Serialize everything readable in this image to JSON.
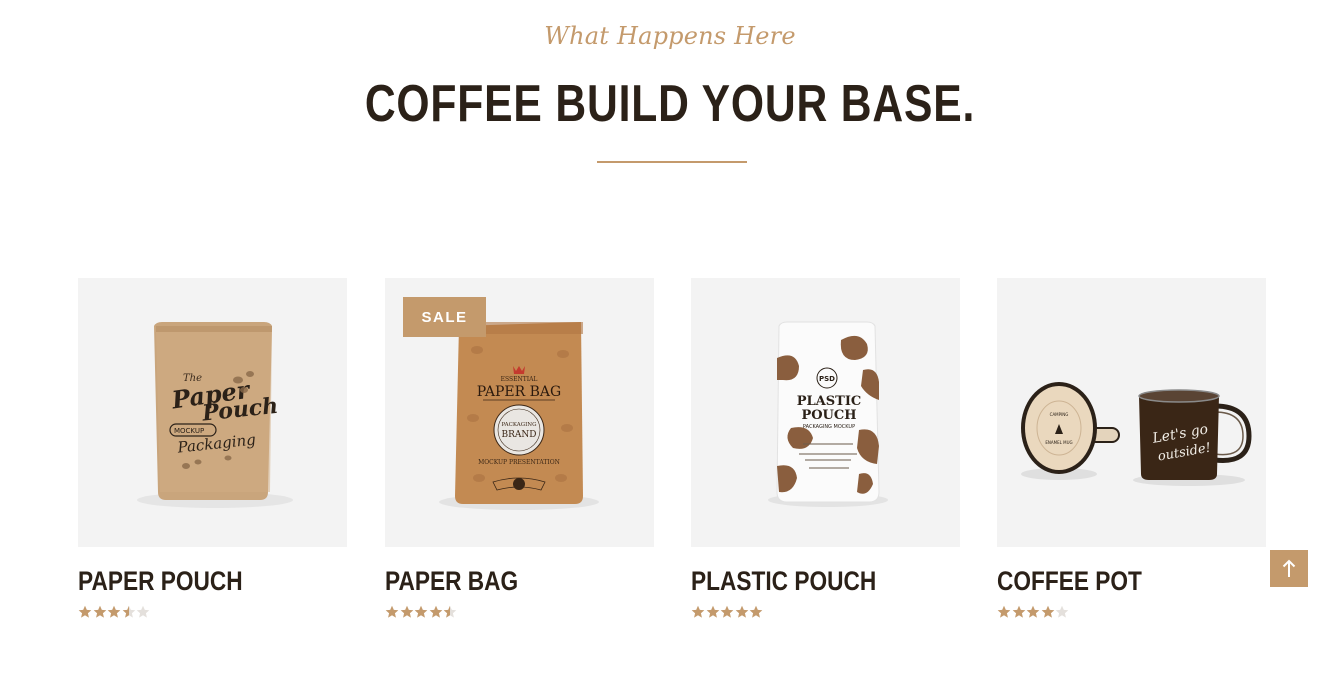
{
  "section": {
    "eyebrow": "What Happens Here",
    "title": "COFFEE BUILD YOUR BASE."
  },
  "colors": {
    "accent": "#c49a6c",
    "heading": "#2b2118",
    "thumb_bg": "#f3f3f3",
    "star_empty": "#e4e0dc"
  },
  "products": [
    {
      "name": "PAPER POUCH",
      "rating": 3.5,
      "rating_max": 5,
      "badge": "",
      "image_lettering": [
        "The",
        "Paper",
        "Pouch",
        "MOCKUP",
        "Packaging"
      ]
    },
    {
      "name": "PAPER BAG",
      "rating": 4.5,
      "rating_max": 5,
      "badge": "SALE",
      "image_lettering": [
        "ESSENTIAL",
        "PAPER BAG",
        "PACKAGING",
        "BRAND",
        "MOCKUP PRESENTATION"
      ]
    },
    {
      "name": "PLASTIC POUCH",
      "rating": 5,
      "rating_max": 5,
      "badge": "",
      "image_lettering": [
        "PSD",
        "PLASTIC",
        "POUCH",
        "PACKAGING MOCKUP"
      ]
    },
    {
      "name": "COFFEE POT",
      "rating": 4,
      "rating_max": 5,
      "badge": "",
      "image_lettering": [
        "Let's go",
        "outside!"
      ]
    }
  ],
  "back_to_top": {
    "icon": "arrow-up-icon"
  }
}
